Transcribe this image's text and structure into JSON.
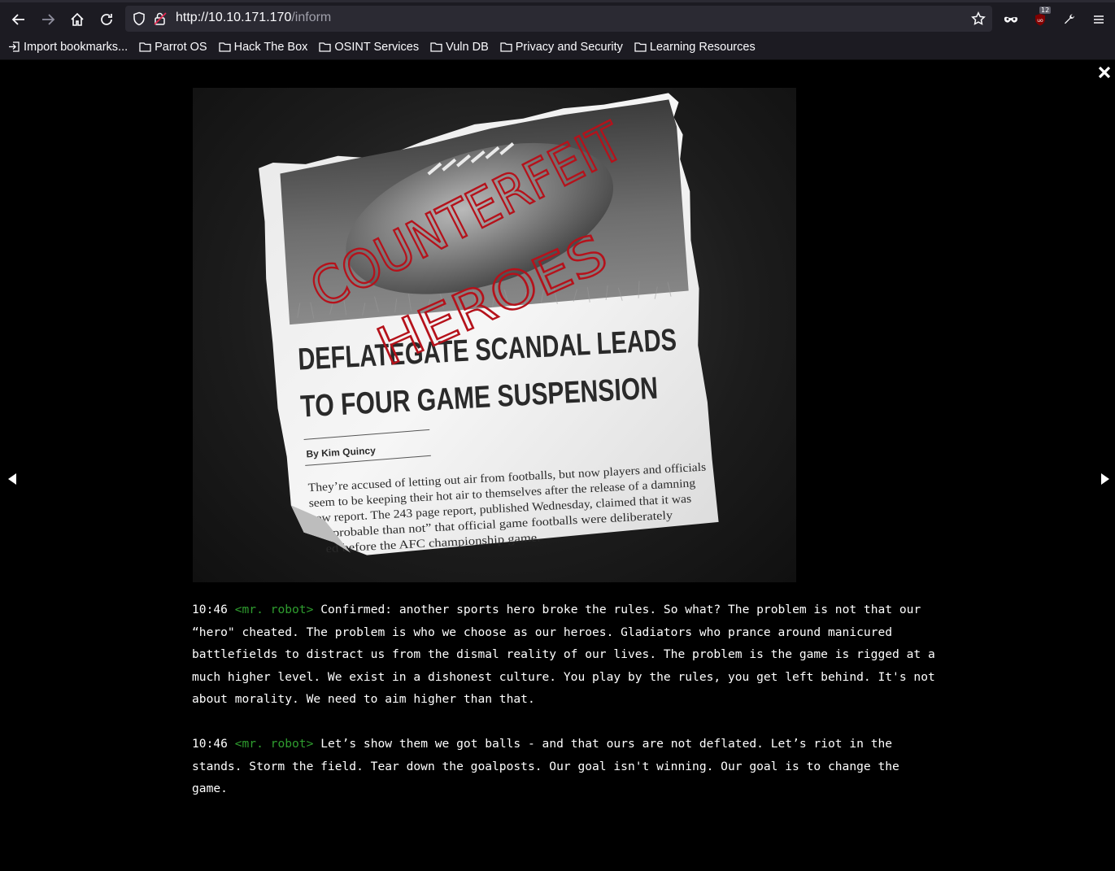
{
  "browser": {
    "url_host": "http://10.10.171.170",
    "url_path": "/inform",
    "extension_badge": "12",
    "bookmarks": [
      {
        "label": "Import bookmarks...",
        "icon": "import-icon"
      },
      {
        "label": "Parrot OS",
        "icon": "folder-icon"
      },
      {
        "label": "Hack The Box",
        "icon": "folder-icon"
      },
      {
        "label": "OSINT Services",
        "icon": "folder-icon"
      },
      {
        "label": "Vuln DB",
        "icon": "folder-icon"
      },
      {
        "label": "Privacy and Security",
        "icon": "folder-icon"
      },
      {
        "label": "Learning Resources",
        "icon": "folder-icon"
      }
    ]
  },
  "image": {
    "graffiti_line1": "COUNTERFEIT",
    "graffiti_line2": "HEROES",
    "headline_line1": "DEFLATEGATE SCANDAL LEADS",
    "headline_line2": "TO FOUR GAME SUSPENSION",
    "byline": "By Kim Quincy",
    "body_lines": [
      "They’re accused of letting out air from footballs, but now players and officials",
      "seem to be keeping their hot air to themselves after the release of a damning",
      "new report. The 243 page report, published Wednesday, claimed that it was",
      "e probable than not” that official game footballs were deliberately",
      "ed before the AFC championship game."
    ]
  },
  "chat": {
    "messages": [
      {
        "time": "10:46",
        "nick": "<mr. robot>",
        "text": " Confirmed: another sports hero broke the rules. So what? The problem is not that our “hero\" cheated. The problem is who we choose as our heroes. Gladiators who prance around manicured battlefields to distract us from the dismal reality of our lives. The problem is the game is rigged at a much higher level. We exist in a dishonest culture. You play by the rules, you get left behind. It's not about morality. We need to aim higher than that."
      },
      {
        "time": "10:46",
        "nick": "<mr. robot>",
        "text": "Let’s show them  we got balls - and that ours are not deflated. Let’s riot in the stands.  Storm the field. Tear down the goalposts. Our goal isn't winning. Our goal is to change the game."
      }
    ]
  },
  "colors": {
    "nick": "#2f9e2f",
    "graffiti": "#b5121b",
    "chrome_bg": "#1c1b22",
    "urlbar_bg": "#2b2a33"
  }
}
